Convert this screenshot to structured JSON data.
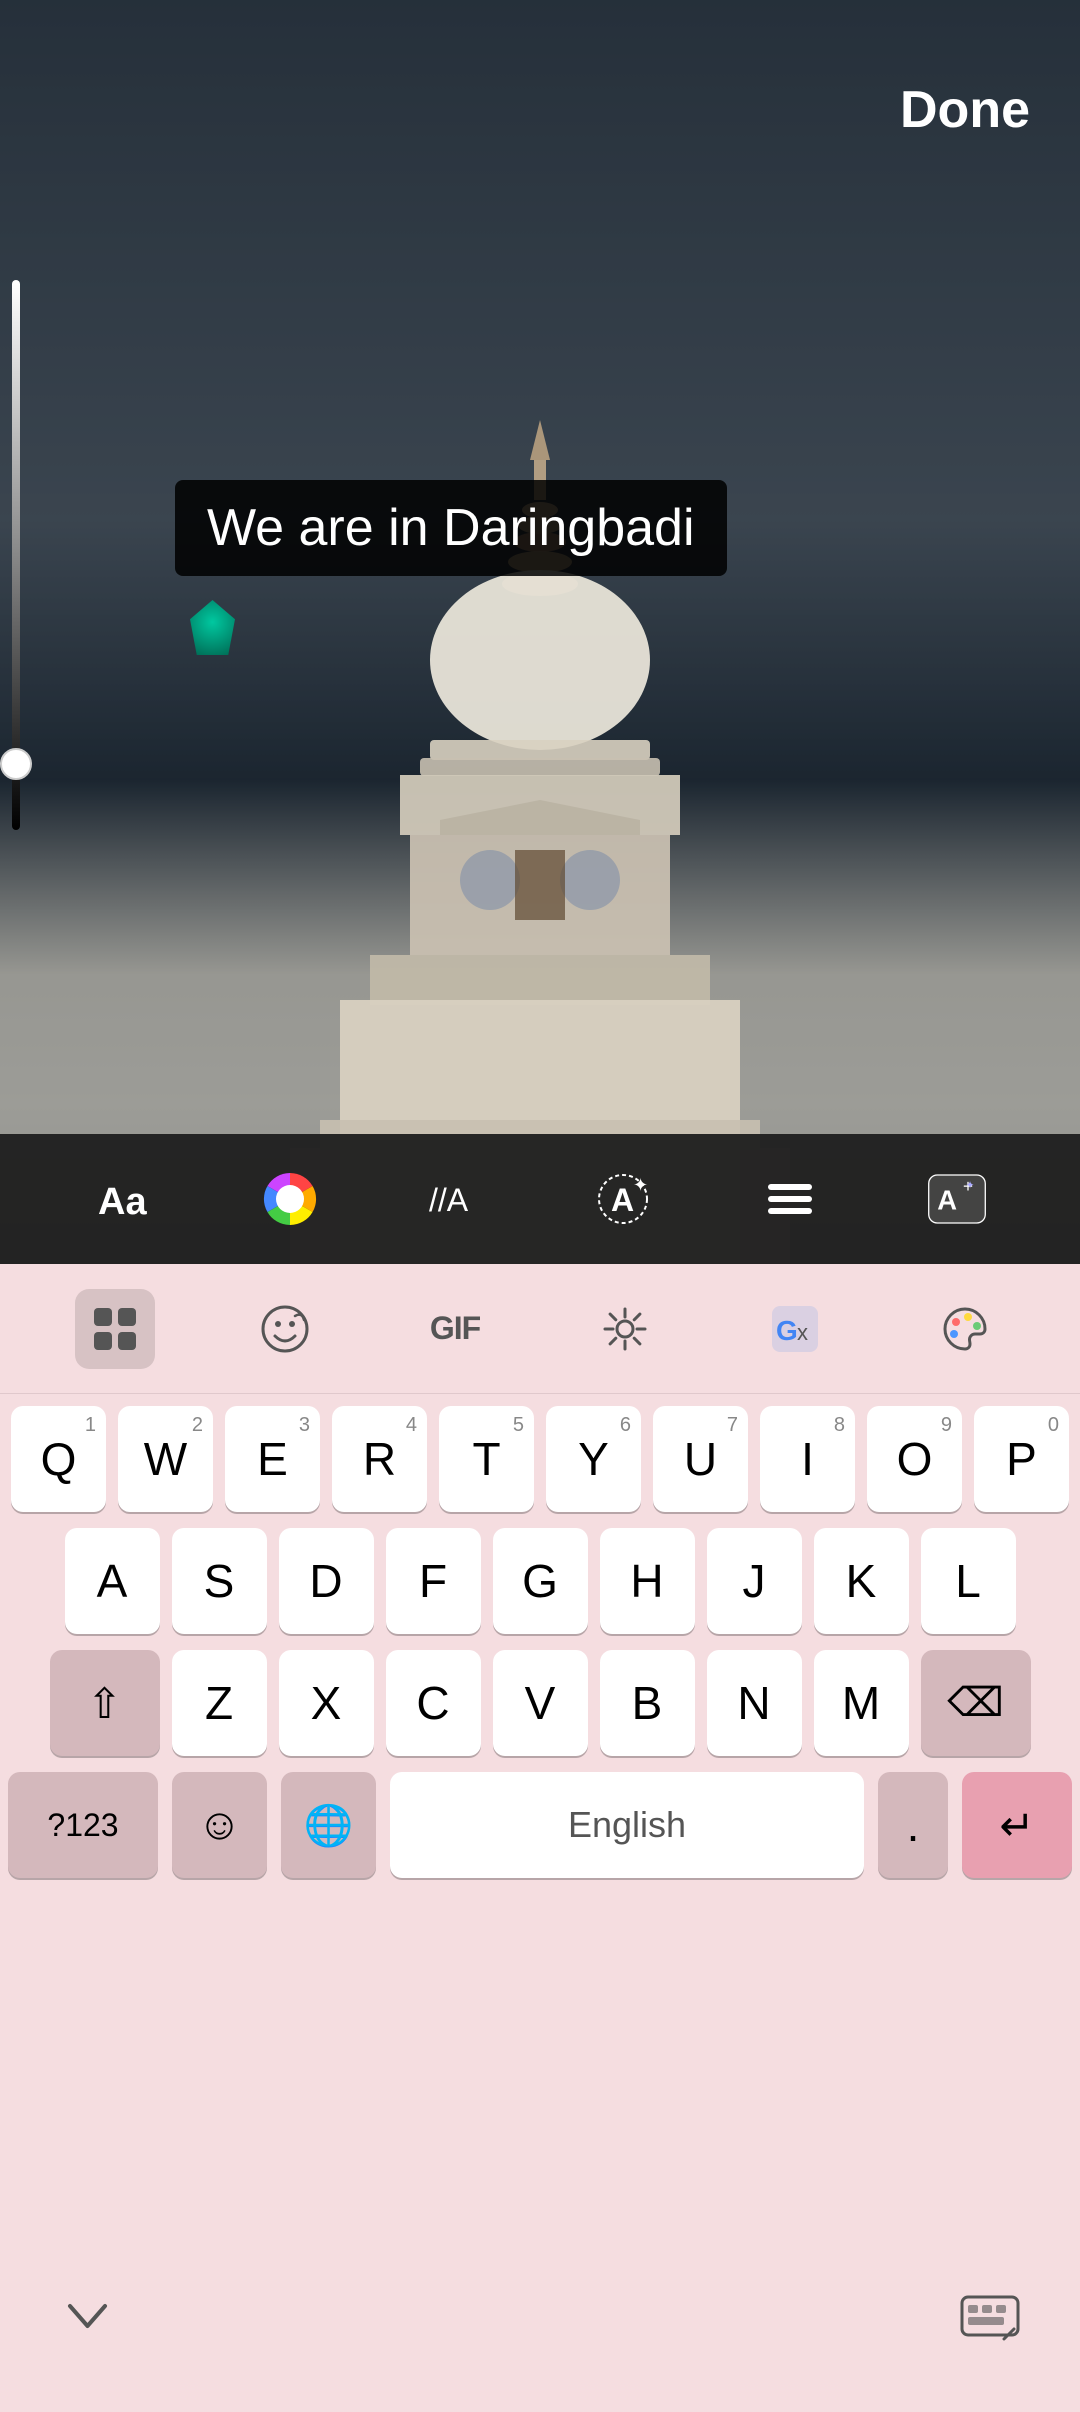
{
  "header": {
    "done_label": "Done"
  },
  "photo": {
    "text_overlay": "We are in Daringbadi"
  },
  "toolbar": {
    "items": [
      {
        "name": "font-button",
        "label": "Aa"
      },
      {
        "name": "color-wheel-button",
        "label": "🎨"
      },
      {
        "name": "style-button",
        "label": "//A"
      },
      {
        "name": "text-bg-button",
        "label": "A✦"
      },
      {
        "name": "align-button",
        "label": "≡"
      },
      {
        "name": "ai-text-button",
        "label": "A+"
      }
    ]
  },
  "emoji_row": {
    "items": [
      {
        "name": "apps-button",
        "label": "⊞",
        "active": true
      },
      {
        "name": "sticker-button",
        "label": "😊"
      },
      {
        "name": "gif-button",
        "label": "GIF"
      },
      {
        "name": "settings-button",
        "label": "⚙"
      },
      {
        "name": "translate-button",
        "label": "Gx"
      },
      {
        "name": "theme-button",
        "label": "🎨"
      }
    ]
  },
  "keyboard": {
    "row1": [
      {
        "key": "Q",
        "num": "1"
      },
      {
        "key": "W",
        "num": "2"
      },
      {
        "key": "E",
        "num": "3"
      },
      {
        "key": "R",
        "num": "4"
      },
      {
        "key": "T",
        "num": "5"
      },
      {
        "key": "Y",
        "num": "6"
      },
      {
        "key": "U",
        "num": "7"
      },
      {
        "key": "I",
        "num": "8"
      },
      {
        "key": "O",
        "num": "9"
      },
      {
        "key": "P",
        "num": "0"
      }
    ],
    "row2": [
      {
        "key": "A"
      },
      {
        "key": "S"
      },
      {
        "key": "D"
      },
      {
        "key": "F"
      },
      {
        "key": "G"
      },
      {
        "key": "H"
      },
      {
        "key": "J"
      },
      {
        "key": "K"
      },
      {
        "key": "L"
      }
    ],
    "row3_left": "⇧",
    "row3": [
      {
        "key": "Z"
      },
      {
        "key": "X"
      },
      {
        "key": "C"
      },
      {
        "key": "V"
      },
      {
        "key": "B"
      },
      {
        "key": "N"
      },
      {
        "key": "M"
      }
    ],
    "row3_right": "⌫",
    "bottom": {
      "numbers_label": "?123",
      "emoji_label": "☺",
      "globe_label": "🌐",
      "space_label": "English",
      "period_label": ".",
      "enter_label": "↵"
    }
  },
  "bottom_bar": {
    "hide_label": "⌄",
    "settings_label": "⌨"
  }
}
